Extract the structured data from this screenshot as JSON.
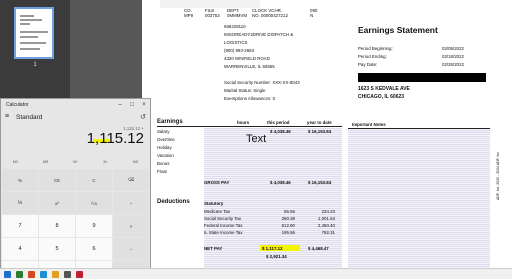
{
  "viewer": {
    "page_number": "1"
  },
  "calculator": {
    "title": "Calculator",
    "mode": "Standard",
    "expression": "1,115.12 +",
    "display": "1,115.12",
    "memory": [
      "MC",
      "MR",
      "M+",
      "M-",
      "MS"
    ],
    "keys": [
      "%",
      "CE",
      "C",
      "⌫",
      "⅟x",
      "x²",
      "²√x",
      "÷",
      "7",
      "8",
      "9",
      "×",
      "4",
      "5",
      "6",
      "−",
      "1",
      "2",
      "3",
      "+"
    ]
  },
  "stub": {
    "headers": [
      "CO.",
      "FILE",
      "DEPT.",
      "CLOCK VCHR.",
      "090"
    ],
    "values": [
      "MP9",
      "003753",
      "0MMMVM",
      "NO. 00000427212",
      "N"
    ],
    "employer_id": "668228110",
    "company_name": "IMSOREADY2DRIVE DISPATCH &",
    "company_name2": "LOGISTICS",
    "phone": "(800) 993-2683",
    "address1": "4320 WINFIELD ROAD",
    "address2": "WARRENVILLE, IL 60555",
    "ssn": "Social Security Number: XXX-XX-8043",
    "marital": "Marital Status: Single",
    "exemptions": "Exemptions Allowances: 0"
  },
  "statement": {
    "title": "Earnings Statement",
    "period_beginning_label": "Period Beginning:",
    "period_beginning": "02/05/2022",
    "period_ending_label": "Period Ending:",
    "period_ending": "02/18/2022",
    "pay_date_label": "Pay Date:",
    "pay_date": "02/25/2022",
    "employee_address1": "1623 S KEDVALE AVE",
    "employee_address2": "CHICAGO, IL 60623",
    "important_notes": "Important Notes",
    "side_code": "ADP, Inc. 2020 - 2024 ADP, Inc."
  },
  "earnings": {
    "heading": "Earnings",
    "col_hours": "hours",
    "col_period": "this period",
    "col_ytd": "year to date",
    "rows": [
      "Salary",
      "Overtime",
      "Holiday",
      "Vacation",
      "Bonus",
      "Float"
    ],
    "salary_period": "$ 4,038.46",
    "salary_ytd": "$ 16,153.84",
    "overlay_text": "Text",
    "gross_pay_label": "GROSS PAY",
    "gross_pay_period": "$ 4,038.46",
    "gross_pay_ytd": "$ 16,153.84"
  },
  "deductions": {
    "heading": "Deductions",
    "statutory": "Statutory",
    "rows": [
      {
        "label": "Medicare Tax",
        "period": "56.56",
        "ytd": "234.23"
      },
      {
        "label": "Social Security Tax",
        "period": "250.38",
        "ytd": "1,001.53"
      },
      {
        "label": "Federal Income Tax",
        "period": "612.60",
        "ytd": "2,450.40"
      },
      {
        "label": "IL State Income Tax",
        "period": "195.56",
        "ytd": "782.31"
      }
    ],
    "net_pay_label": "NET PAY",
    "net_pay_period": "$ 1,117.12",
    "net_pay_ytd": "$ 4,468.47",
    "net_pay_check": "$ 2,921.34"
  }
}
